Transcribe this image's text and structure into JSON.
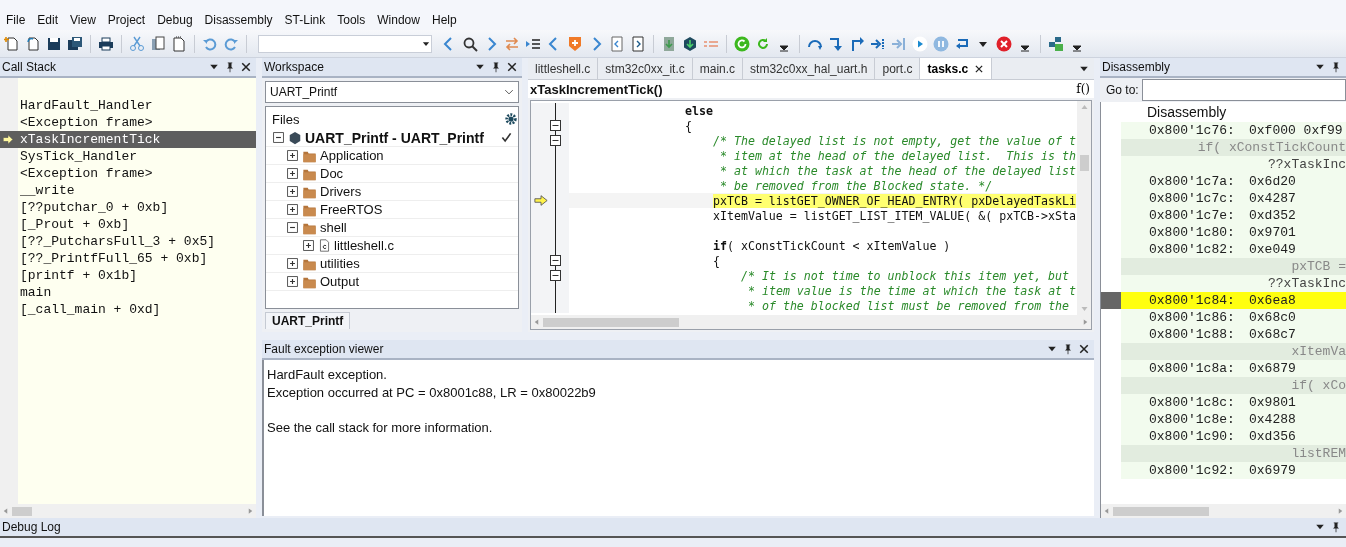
{
  "menu": [
    "File",
    "Edit",
    "View",
    "Project",
    "Debug",
    "Disassembly",
    "ST-Link",
    "Tools",
    "Window",
    "Help"
  ],
  "call_stack": {
    "title": "Call Stack",
    "frames": [
      {
        "name": "HardFault_Handler",
        "selected": false
      },
      {
        "name": "<Exception frame>",
        "selected": false
      },
      {
        "name": "xTaskIncrementTick",
        "selected": true
      },
      {
        "name": "SysTick_Handler",
        "selected": false
      },
      {
        "name": "<Exception frame>",
        "selected": false
      },
      {
        "name": "__write",
        "selected": false
      },
      {
        "name": "[??putchar_0 + 0xb]",
        "selected": false
      },
      {
        "name": "[_Prout + 0xb]",
        "selected": false
      },
      {
        "name": "[??_PutcharsFull_3 + 0x5]",
        "selected": false
      },
      {
        "name": "[??_PrintfFull_65 + 0xb]",
        "selected": false
      },
      {
        "name": "[printf + 0x1b]",
        "selected": false
      },
      {
        "name": "main",
        "selected": false
      },
      {
        "name": "[_call_main + 0xd]",
        "selected": false
      }
    ]
  },
  "workspace": {
    "title": "Workspace",
    "configuration": "UART_Printf",
    "files_header": "Files",
    "project": {
      "name": "UART_Printf - UART_Printf",
      "checked": true,
      "children": [
        {
          "name": "Application",
          "kind": "folder",
          "expanded": false
        },
        {
          "name": "Doc",
          "kind": "folder",
          "expanded": false
        },
        {
          "name": "Drivers",
          "kind": "folder",
          "expanded": false
        },
        {
          "name": "FreeRTOS",
          "kind": "folder",
          "expanded": false
        },
        {
          "name": "shell",
          "kind": "folder",
          "expanded": true,
          "children": [
            {
              "name": "littleshell.c",
              "kind": "file",
              "expanded": false
            }
          ]
        },
        {
          "name": "utilities",
          "kind": "folder",
          "expanded": false
        },
        {
          "name": "Output",
          "kind": "folder",
          "expanded": false
        }
      ]
    },
    "tab": "UART_Printf"
  },
  "editor": {
    "tabs": [
      {
        "label": "littleshell.c",
        "selected": false
      },
      {
        "label": "stm32c0xx_it.c",
        "selected": false
      },
      {
        "label": "main.c",
        "selected": false
      },
      {
        "label": "stm32c0xx_hal_uart.h",
        "selected": false
      },
      {
        "label": "port.c",
        "selected": false
      },
      {
        "label": "tasks.c",
        "selected": true
      }
    ],
    "function": "xTaskIncrementTick()",
    "function_button": "f()",
    "lines": [
      {
        "kind": "code",
        "text": "                **else**",
        "current": false,
        "fold": false
      },
      {
        "kind": "code",
        "text": "                {",
        "current": false,
        "fold": true
      },
      {
        "kind": "comment",
        "text": "                    /* The delayed list is not empty, get the value of t",
        "current": false,
        "fold": true
      },
      {
        "kind": "comment",
        "text": "                     * item at the head of the delayed list.  This is th",
        "current": false,
        "fold": false
      },
      {
        "kind": "comment",
        "text": "                     * at which the task at the head of the delayed list",
        "current": false,
        "fold": false
      },
      {
        "kind": "comment",
        "text": "                     * be removed from the Blocked state. */",
        "current": false,
        "fold": false
      },
      {
        "kind": "code",
        "text": "                    pxTCB = listGET_OWNER_OF_HEAD_ENTRY( pxDelayedTaskLi",
        "current": true,
        "fold": false
      },
      {
        "kind": "code",
        "text": "                    xItemValue = listGET_LIST_ITEM_VALUE( &( pxTCB->xSta",
        "current": false,
        "fold": false
      },
      {
        "kind": "blank",
        "current": false,
        "fold": false
      },
      {
        "kind": "code",
        "text": "                    **if**( xConstTickCount < xItemValue )",
        "current": false,
        "fold": false
      },
      {
        "kind": "code",
        "text": "                    {",
        "current": false,
        "fold": true
      },
      {
        "kind": "comment",
        "text": "                        /* It is not time to unblock this item yet, but",
        "current": false,
        "fold": true
      },
      {
        "kind": "comment",
        "text": "                         * item value is the time at which the task at t",
        "current": false,
        "fold": false
      },
      {
        "kind": "comment",
        "text": "                         * of the blocked list must be removed from the",
        "current": false,
        "fold": false
      }
    ]
  },
  "fault_viewer": {
    "title": "Fault exception viewer",
    "message": [
      "HardFault exception.",
      "Exception occurred at PC = 0x8001c88, LR = 0x80022b9"
    ],
    "hint": "See the call stack for more information."
  },
  "disassembly": {
    "title": "Disassembly",
    "goto_label": "Go to:",
    "header": "Disassembly",
    "rows": [
      {
        "kind": "instruction",
        "address": "0x800'1c76:",
        "code": "0xf000 0xf99",
        "current": false
      },
      {
        "kind": "source",
        "text": "if( xConstTickCount",
        "current": false
      },
      {
        "kind": "label",
        "text": "??xTaskInc",
        "current": false
      },
      {
        "kind": "instruction",
        "address": "0x800'1c7a:",
        "code": "0x6d20",
        "current": false
      },
      {
        "kind": "instruction",
        "address": "0x800'1c7c:",
        "code": "0x4287",
        "current": false
      },
      {
        "kind": "instruction",
        "address": "0x800'1c7e:",
        "code": "0xd352",
        "current": false
      },
      {
        "kind": "instruction",
        "address": "0x800'1c80:",
        "code": "0x9701",
        "current": false
      },
      {
        "kind": "instruction",
        "address": "0x800'1c82:",
        "code": "0xe049",
        "current": false
      },
      {
        "kind": "source",
        "text": "pxTCB =",
        "current": false
      },
      {
        "kind": "label",
        "text": "??xTaskInc",
        "current": false
      },
      {
        "kind": "instruction",
        "address": "0x800'1c84:",
        "code": "0x6ea8",
        "current": true
      },
      {
        "kind": "instruction",
        "address": "0x800'1c86:",
        "code": "0x68c0",
        "current": false
      },
      {
        "kind": "instruction",
        "address": "0x800'1c88:",
        "code": "0x68c7",
        "current": false
      },
      {
        "kind": "source",
        "text": "xItemVa",
        "current": false
      },
      {
        "kind": "instruction",
        "address": "0x800'1c8a:",
        "code": "0x6879",
        "current": false
      },
      {
        "kind": "source",
        "text": "if( xCo",
        "current": false
      },
      {
        "kind": "instruction",
        "address": "0x800'1c8c:",
        "code": "0x9801",
        "current": false
      },
      {
        "kind": "instruction",
        "address": "0x800'1c8e:",
        "code": "0x4288",
        "current": false
      },
      {
        "kind": "instruction",
        "address": "0x800'1c90:",
        "code": "0xd356",
        "current": false
      },
      {
        "kind": "source",
        "text": "listREM",
        "current": false
      },
      {
        "kind": "instruction",
        "address": "0x800'1c92:",
        "code": "0x6979",
        "current": false
      }
    ]
  },
  "debug_log": {
    "title": "Debug Log"
  }
}
